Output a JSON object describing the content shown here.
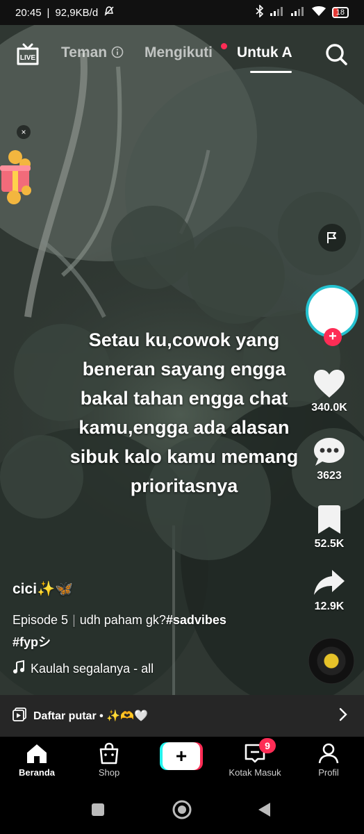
{
  "status_bar": {
    "time": "20:45",
    "speed": "92,9KB/d",
    "battery": "18"
  },
  "top_nav": {
    "live_label": "LIVE",
    "tabs": [
      {
        "label": "Teman",
        "has_info_icon": true,
        "active": false
      },
      {
        "label": "Mengikuti",
        "has_dot": true,
        "active": false
      },
      {
        "label": "Untuk A",
        "active": true
      }
    ]
  },
  "gift_widget": {
    "close_label": "×"
  },
  "caption": {
    "lines": [
      "Setau ku,cowok yang",
      "beneran sayang engga",
      "bakal tahan engga chat",
      "kamu,engga ada alasan",
      "sibuk kalo kamu memang",
      "prioritasnya"
    ]
  },
  "right_rail": {
    "likes": "340.0K",
    "comments": "3623",
    "saves": "52.5K",
    "shares": "12.9K",
    "follow_label": "+"
  },
  "post": {
    "username": "cici✨🦋",
    "episode": "Episode 5",
    "description": "udh paham gk?",
    "hashtag1": "#sadvibes",
    "hashtag2": "#fypシ",
    "music": "Kaulah segalanya - all"
  },
  "playlist": {
    "label": "Daftar putar • ✨🫶🤍"
  },
  "tabbar": {
    "home": "Beranda",
    "shop": "Shop",
    "create": "+",
    "inbox": "Kotak Masuk",
    "inbox_badge": "9",
    "profile": "Profil"
  },
  "colors": {
    "accent_red": "#fe2c55",
    "accent_cyan": "#25c2d0",
    "playlist_bg": "#282828"
  }
}
